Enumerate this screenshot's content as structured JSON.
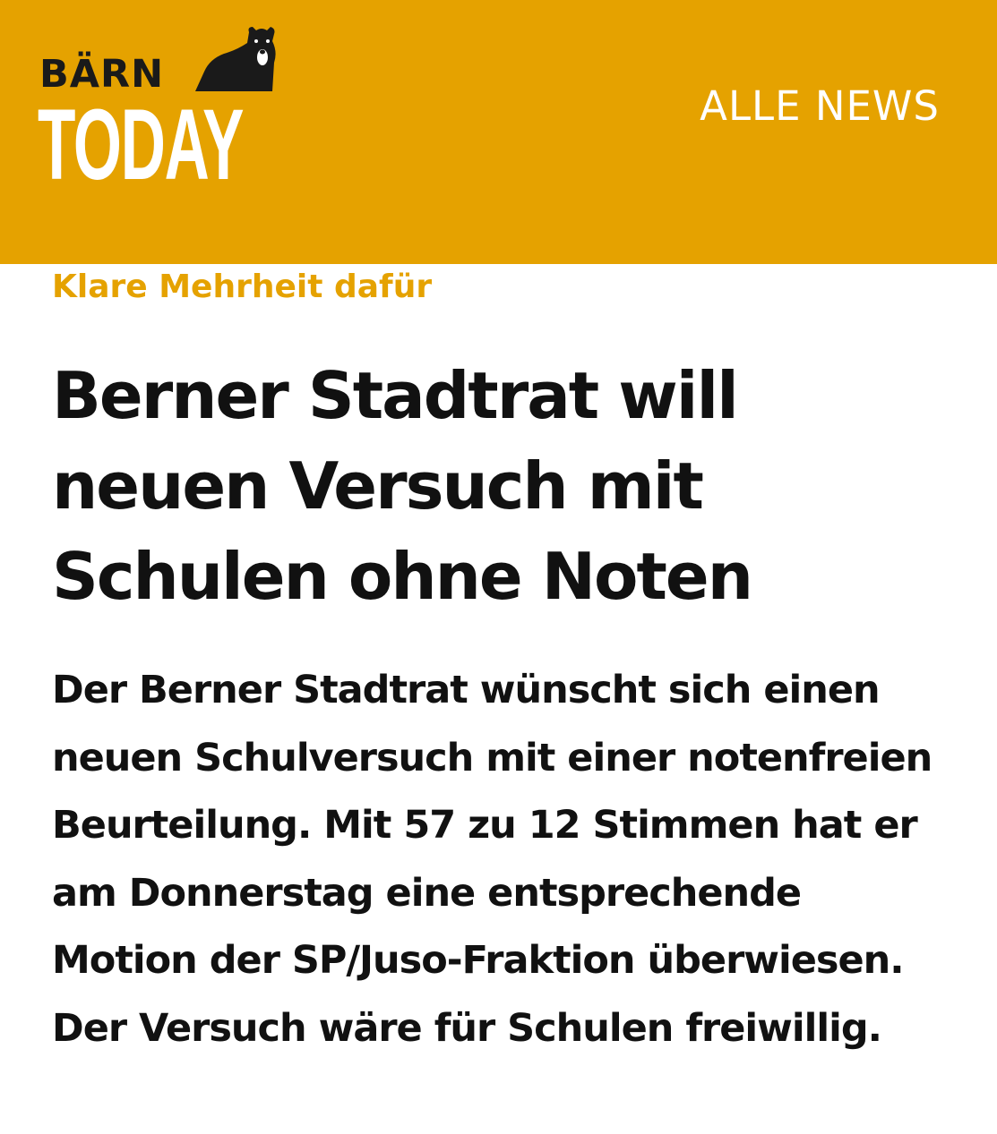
{
  "header": {
    "logo": {
      "line1": "BÄRN",
      "line2": "TODAY",
      "icon": "bear-icon"
    },
    "nav_link": "ALLE NEWS"
  },
  "article": {
    "kicker": "Klare Mehrheit dafür",
    "headline": "Berner Stadtrat will neuen Versuch mit Schulen ohne Noten",
    "lead": "Der Berner Stadtrat wünscht sich einen neuen Schulversuch mit einer notenfreien Beurteilung. Mit 57 zu 12 Stimmen hat er am Donnerstag eine entsprechende Motion der SP/Juso-Fraktion überwiesen. Der Versuch wäre für Schulen freiwillig."
  },
  "colors": {
    "brand": "#e5a200",
    "text": "#111111",
    "background": "#ffffff"
  }
}
